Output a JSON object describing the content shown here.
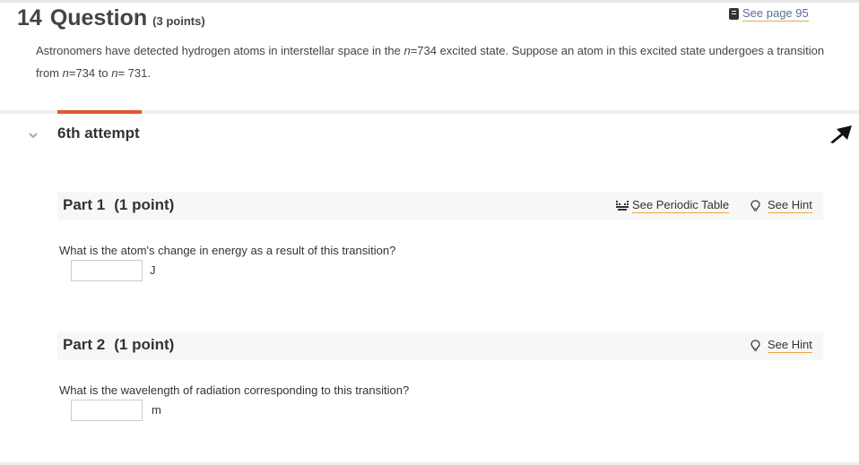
{
  "question": {
    "number": "14",
    "word": "Question",
    "points": "(3 points)",
    "text_part1": "Astronomers have detected hydrogen atoms in interstellar space in the ",
    "var_n": "n",
    "text_part2": "=734 excited state. Suppose an atom in this excited state undergoes a transition from ",
    "text_part3": "=734 to ",
    "text_part4": "= 731."
  },
  "see_page": {
    "label": "See page 95",
    "icon": "book-icon"
  },
  "attempt": {
    "label": "6th attempt",
    "accent_color": "#e1572e"
  },
  "parts": [
    {
      "title": "Part 1",
      "points": "(1 point)",
      "prompt": "What is the atom's change in energy as a result of this transition?",
      "answer_value": "",
      "unit": "J",
      "tools": [
        {
          "label": "See Periodic Table",
          "icon": "periodic-table-icon"
        },
        {
          "label": "See Hint",
          "icon": "lightbulb-icon"
        }
      ]
    },
    {
      "title": "Part 2",
      "points": "(1 point)",
      "prompt": "What is the wavelength of radiation corresponding to this transition?",
      "answer_value": "",
      "unit": "m",
      "tools": [
        {
          "label": "See Hint",
          "icon": "lightbulb-icon"
        }
      ]
    }
  ],
  "colors": {
    "link_underline": "#e8a93a",
    "link_text": "#5a6e99"
  }
}
